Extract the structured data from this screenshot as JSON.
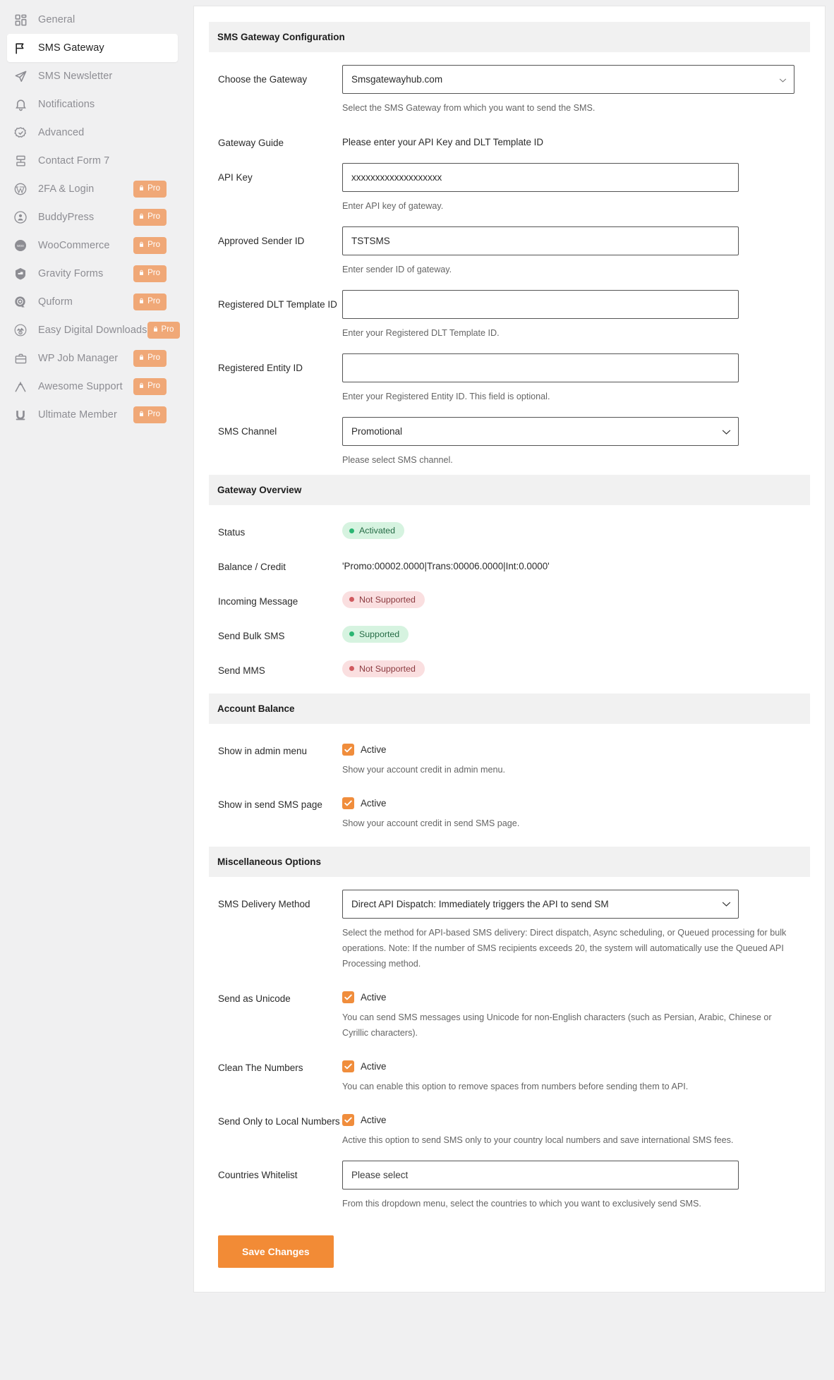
{
  "sidebar": {
    "items": [
      {
        "label": "General",
        "icon": "grid-icon",
        "pro": false,
        "active": false
      },
      {
        "label": "SMS Gateway",
        "icon": "flag-icon",
        "pro": false,
        "active": true
      },
      {
        "label": "SMS Newsletter",
        "icon": "send-icon",
        "pro": false,
        "active": false
      },
      {
        "label": "Notifications",
        "icon": "bell-icon",
        "pro": false,
        "active": false
      },
      {
        "label": "Advanced",
        "icon": "badge-check-icon",
        "pro": false,
        "active": false
      },
      {
        "label": "Contact Form 7",
        "icon": "contact-form-icon",
        "pro": false,
        "active": false
      },
      {
        "label": "2FA & Login",
        "icon": "wordpress-icon",
        "pro": true,
        "active": false
      },
      {
        "label": "BuddyPress",
        "icon": "buddypress-icon",
        "pro": true,
        "active": false
      },
      {
        "label": "WooCommerce",
        "icon": "woocommerce-icon",
        "pro": true,
        "active": false
      },
      {
        "label": "Gravity Forms",
        "icon": "gravity-forms-icon",
        "pro": true,
        "active": false
      },
      {
        "label": "Quform",
        "icon": "quform-icon",
        "pro": true,
        "active": false
      },
      {
        "label": "Easy Digital Downloads",
        "icon": "edd-icon",
        "pro": true,
        "active": false
      },
      {
        "label": "WP Job Manager",
        "icon": "job-manager-icon",
        "pro": true,
        "active": false
      },
      {
        "label": "Awesome Support",
        "icon": "awesome-support-icon",
        "pro": true,
        "active": false
      },
      {
        "label": "Ultimate Member",
        "icon": "ultimate-member-icon",
        "pro": true,
        "active": false
      }
    ],
    "pro_badge_label": "Pro"
  },
  "sections": {
    "gateway_config": {
      "title": "SMS Gateway Configuration"
    },
    "gateway_overview": {
      "title": "Gateway Overview"
    },
    "account_balance": {
      "title": "Account Balance"
    },
    "misc_options": {
      "title": "Miscellaneous Options"
    }
  },
  "fields": {
    "choose_gateway": {
      "label": "Choose the Gateway",
      "value": "Smsgatewayhub.com",
      "help": "Select the SMS Gateway from which you want to send the SMS."
    },
    "gateway_guide": {
      "label": "Gateway Guide",
      "value": "Please enter your API Key and DLT Template ID"
    },
    "api_key": {
      "label": "API Key",
      "value": "xxxxxxxxxxxxxxxxxxx",
      "help": "Enter API key of gateway."
    },
    "sender_id": {
      "label": "Approved Sender ID",
      "value": "TSTSMS",
      "help": "Enter sender ID of gateway."
    },
    "dlt_template_id": {
      "label": "Registered DLT Template ID",
      "value": "",
      "help": "Enter your Registered DLT Template ID."
    },
    "entity_id": {
      "label": "Registered Entity ID",
      "value": "",
      "help": "Enter your Registered Entity ID. This field is optional."
    },
    "sms_channel": {
      "label": "SMS Channel",
      "value": "Promotional",
      "help": "Please select SMS channel."
    }
  },
  "overview": {
    "status": {
      "label": "Status",
      "badge": "Activated",
      "state": "ok"
    },
    "balance": {
      "label": "Balance / Credit",
      "value": "'Promo:00002.0000|Trans:00006.0000|Int:0.0000'"
    },
    "incoming": {
      "label": "Incoming Message",
      "badge": "Not Supported",
      "state": "bad"
    },
    "bulk": {
      "label": "Send Bulk SMS",
      "badge": "Supported",
      "state": "ok"
    },
    "mms": {
      "label": "Send MMS",
      "badge": "Not Supported",
      "state": "bad"
    }
  },
  "balance_settings": {
    "admin_menu": {
      "label": "Show in admin menu",
      "checkbox_label": "Active",
      "checked": true,
      "help": "Show your account credit in admin menu."
    },
    "send_sms_page": {
      "label": "Show in send SMS page",
      "checkbox_label": "Active",
      "checked": true,
      "help": "Show your account credit in send SMS page."
    }
  },
  "misc": {
    "delivery_method": {
      "label": "SMS Delivery Method",
      "value": "Direct API Dispatch: Immediately triggers the API to send SM",
      "help": "Select the method for API-based SMS delivery: Direct dispatch, Async scheduling, or Queued processing for bulk operations. Note: If the number of SMS recipients exceeds 20, the system will automatically use the Queued API Processing method."
    },
    "unicode": {
      "label": "Send as Unicode",
      "checkbox_label": "Active",
      "checked": true,
      "help": "You can send SMS messages using Unicode for non-English characters (such as Persian, Arabic, Chinese or Cyrillic characters)."
    },
    "clean_numbers": {
      "label": "Clean The Numbers",
      "checkbox_label": "Active",
      "checked": true,
      "help": "You can enable this option to remove spaces from numbers before sending them to API."
    },
    "local_numbers": {
      "label": "Send Only to Local Numbers",
      "checkbox_label": "Active",
      "checked": true,
      "help": "Active this option to send SMS only to your country local numbers and save international SMS fees."
    },
    "countries_whitelist": {
      "label": "Countries Whitelist",
      "placeholder": "Please select",
      "help": "From this dropdown menu, select the countries to which you want to exclusively send SMS."
    }
  },
  "actions": {
    "save_label": "Save Changes"
  },
  "colors": {
    "accent": "#f28b36",
    "pro_badge": "#f0a877",
    "ok": "#2bb673",
    "bad": "#d05a5f"
  }
}
